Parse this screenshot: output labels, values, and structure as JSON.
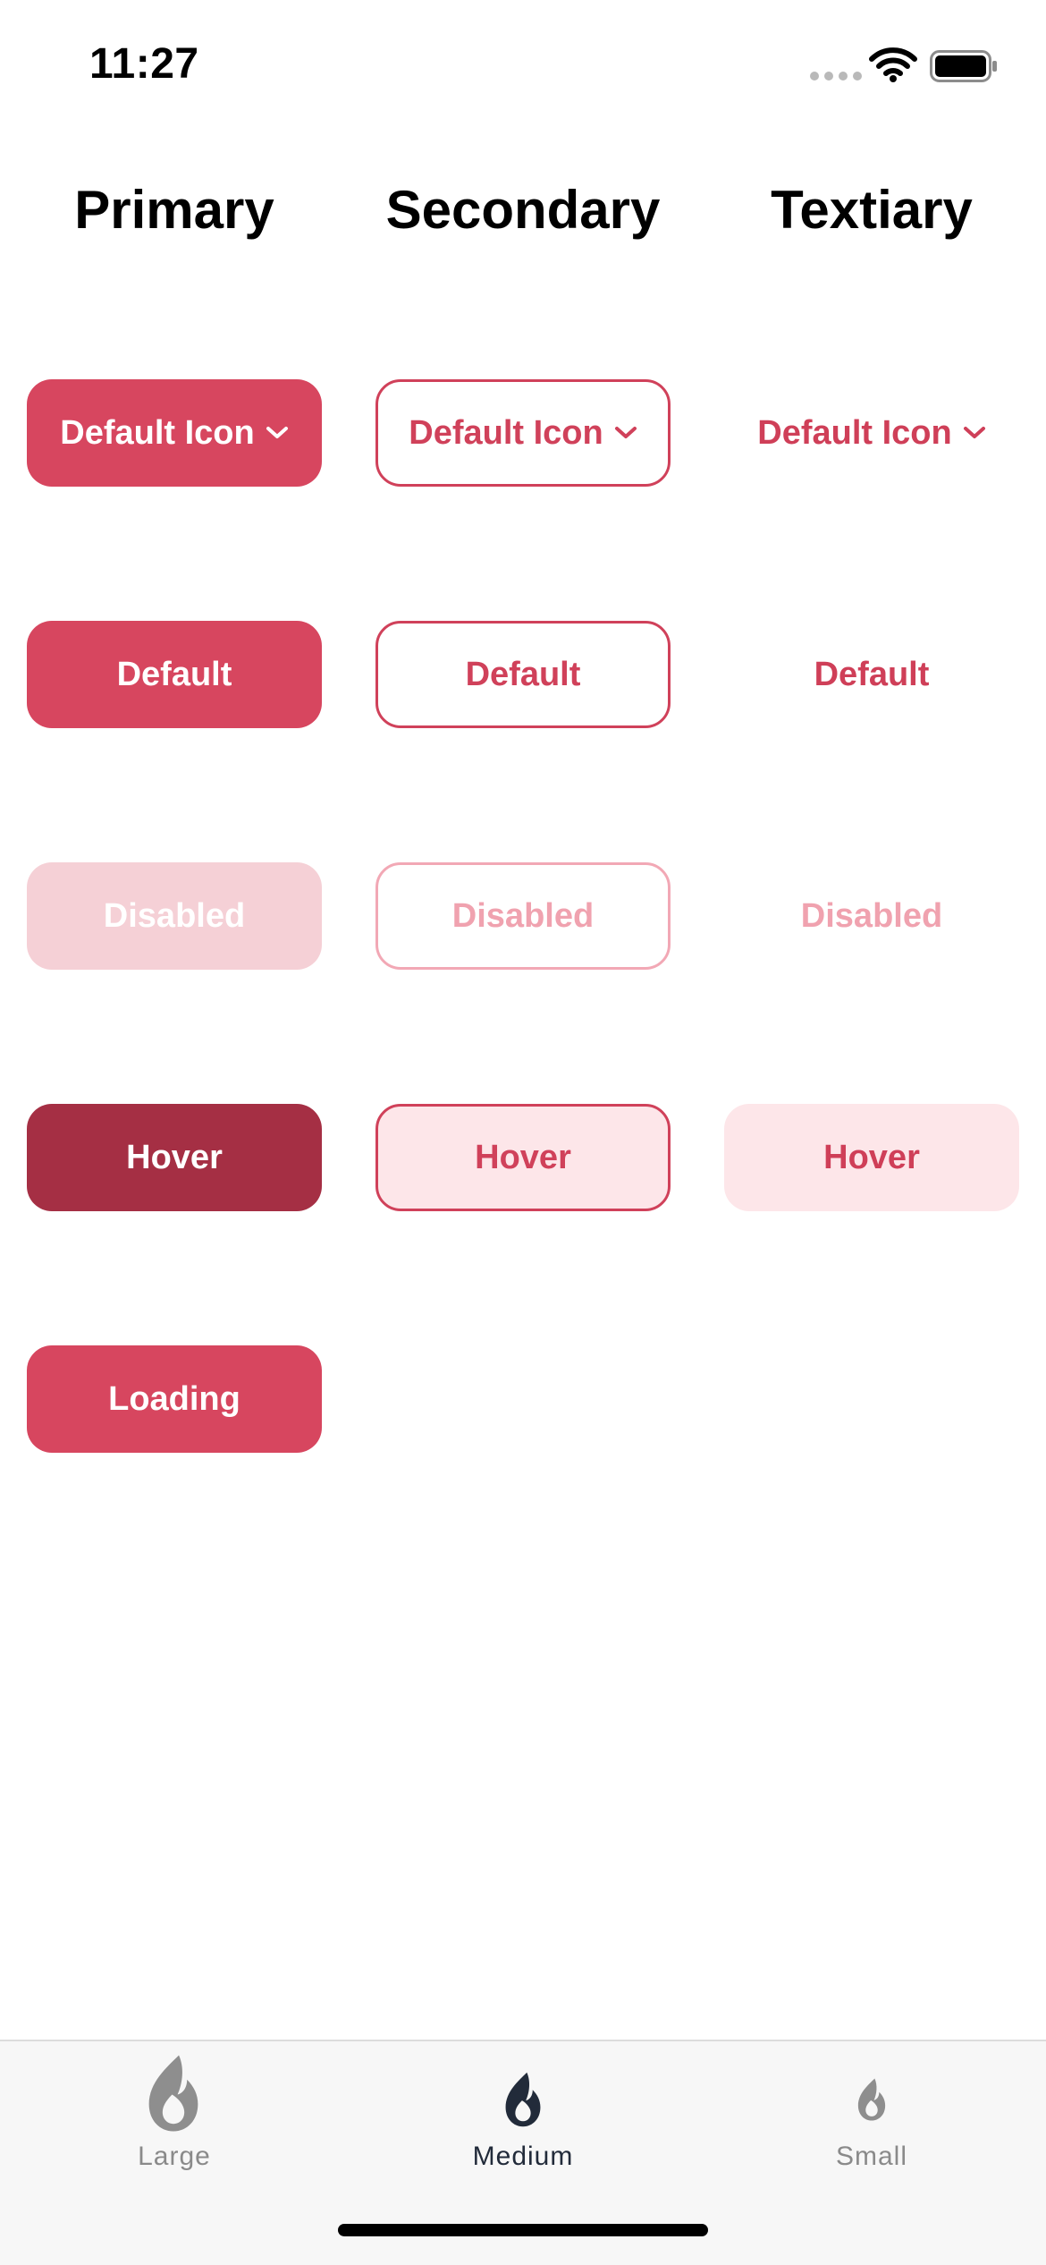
{
  "status_bar": {
    "time": "11:27",
    "icons": [
      "signal-dots-icon",
      "wifi-icon",
      "battery-icon"
    ]
  },
  "columns": {
    "primary": "Primary",
    "secondary": "Secondary",
    "tertiary": "Textiary"
  },
  "buttons": {
    "primary": {
      "default_icon": "Default Icon",
      "default": "Default",
      "disabled": "Disabled",
      "hover": "Hover",
      "loading": "Loading"
    },
    "secondary": {
      "default_icon": "Default Icon",
      "default": "Default",
      "disabled": "Disabled",
      "hover": "Hover"
    },
    "tertiary": {
      "default_icon": "Default Icon",
      "default": "Default",
      "disabled": "Disabled",
      "hover": "Hover"
    }
  },
  "tab_bar": {
    "tabs": [
      {
        "label": "Large",
        "icon": "flame-icon",
        "active": false
      },
      {
        "label": "Medium",
        "icon": "flame-icon",
        "active": true
      },
      {
        "label": "Small",
        "icon": "flame-icon",
        "active": false
      }
    ]
  },
  "colors": {
    "primary": "#d7465f",
    "primary_hover": "#a52f44",
    "primary_disabled": "#f5d0d6",
    "secondary_border": "#d0415a",
    "hover_tint": "#fde6e9",
    "tab_active": "#222b3a",
    "tab_inactive": "#8a8a8a"
  }
}
